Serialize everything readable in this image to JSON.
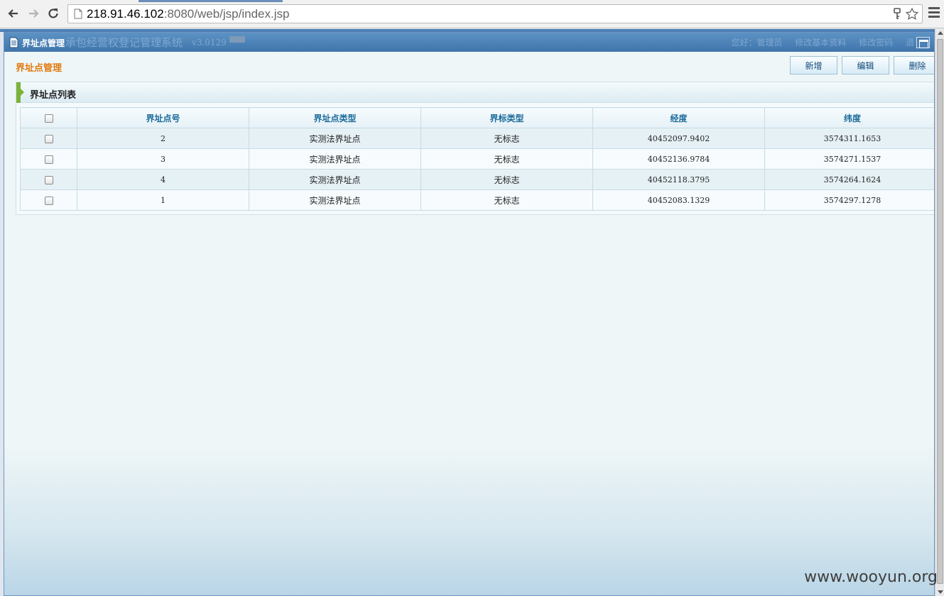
{
  "browser": {
    "url_host": "218.91.46.102",
    "url_rest": ":8080/web/jsp/index.jsp"
  },
  "app": {
    "window_title": "界址点管理",
    "system_title": "承包经营权登记管理系统",
    "version": "v3.0129",
    "user_greeting": "您好：管理员",
    "edit_profile": "修改基本资料",
    "change_password": "修改密码",
    "logout": "退"
  },
  "page": {
    "title": "界址点管理",
    "toolbar": {
      "add": "新增",
      "edit": "编辑",
      "delete": "删除"
    },
    "panel_title": "界址点列表"
  },
  "table": {
    "columns": [
      "界址点号",
      "界址点类型",
      "界标类型",
      "经度",
      "纬度"
    ],
    "rows": [
      {
        "point_no": "2",
        "point_type": "实测法界址点",
        "marker_type": "无标志",
        "longitude": "40452097.9402",
        "latitude": "3574311.1653"
      },
      {
        "point_no": "3",
        "point_type": "实测法界址点",
        "marker_type": "无标志",
        "longitude": "40452136.9784",
        "latitude": "3574271.1537"
      },
      {
        "point_no": "4",
        "point_type": "实测法界址点",
        "marker_type": "无标志",
        "longitude": "40452118.3795",
        "latitude": "3574264.1624"
      },
      {
        "point_no": "1",
        "point_type": "实测法界址点",
        "marker_type": "无标志",
        "longitude": "40452083.1329",
        "latitude": "3574297.1278"
      }
    ]
  },
  "watermark": "www.wooyun.org"
}
